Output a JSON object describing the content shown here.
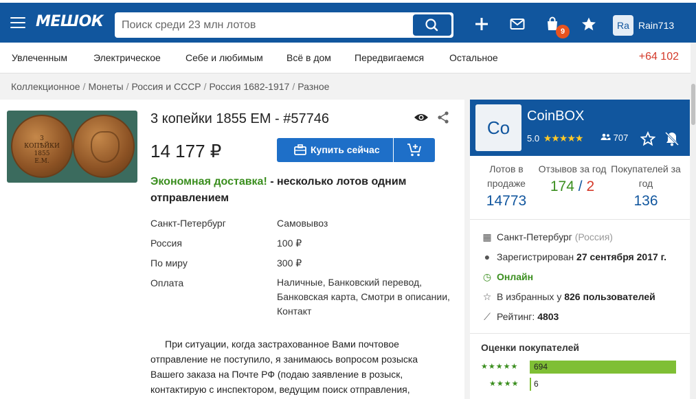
{
  "header": {
    "logo": "МЕШОК",
    "search_placeholder": "Поиск среди 23 млн лотов",
    "notifications_count": "9",
    "avatar_initials": "Ra",
    "username": "Rain713",
    "colors": {
      "brand": "#11569e",
      "badge": "#e8531f"
    }
  },
  "categories": {
    "items": [
      "Увлеченным",
      "Электрическое",
      "Себе и любимым",
      "Всё в дом",
      "Передвигаемся",
      "Остальное"
    ],
    "count": "+64 102"
  },
  "breadcrumbs": [
    "Коллекционное",
    "Монеты",
    "Россия и СССР",
    "Россия 1682-1917",
    "Разное"
  ],
  "lot": {
    "title": "3 копейки 1855 ЕМ - #57746",
    "price": "14 177 ₽",
    "buy_label": "Купить сейчас",
    "delivery_promo": "Экономная доставка!",
    "delivery_text": " - несколько лотов одним отправлением",
    "shipping": [
      {
        "label": "Санкт-Петербург",
        "value": "Самовывоз"
      },
      {
        "label": "Россия",
        "value": "100 ₽"
      },
      {
        "label": "По миру",
        "value": "300 ₽"
      },
      {
        "label": "Оплата",
        "value": "Наличные, Банковский перевод, Банковская карта, Смотри в описании, Контакт"
      }
    ],
    "description": "При ситуации, когда застрахованное Вами почтовое отправление не поступило, я занимаюсь вопросом розыска Вашего заказа на Почте РФ (подаю заявление в розыск, контактирую с инспектором, ведущим поиск отправления,",
    "photo_coin_text": [
      "3",
      "КОПѢЙКИ",
      "1855",
      "Е.М."
    ]
  },
  "seller": {
    "logo_text": "Co",
    "name": "CoinBOX",
    "rating": "5.0",
    "stars": "★★★★★",
    "fans": "707",
    "stats": {
      "lots_label": "Лотов в продаже",
      "lots_value": "14773",
      "reviews_label": "Отзывов за год",
      "reviews_positive": "174",
      "reviews_sep": " / ",
      "reviews_negative": "2",
      "buyers_label": "Покупателей за год",
      "buyers_value": "136"
    },
    "city": "Санкт-Петербург",
    "country": "(Россия)",
    "registered_prefix": "Зарегистрирован ",
    "registered_date": "27 сентября 2017 г.",
    "online": "Онлайн",
    "favorites_prefix": "В избранных у ",
    "favorites_count": "826 пользователей",
    "rating_prefix": "Рейтинг: ",
    "rating_value": "4803",
    "reviews_title": "Оценки покупателей",
    "review_rows": [
      {
        "stars": "★★★★★",
        "count": "694",
        "fraction": 1.0
      },
      {
        "stars": "★★★★",
        "count": "6",
        "fraction": 0.0086
      }
    ]
  }
}
